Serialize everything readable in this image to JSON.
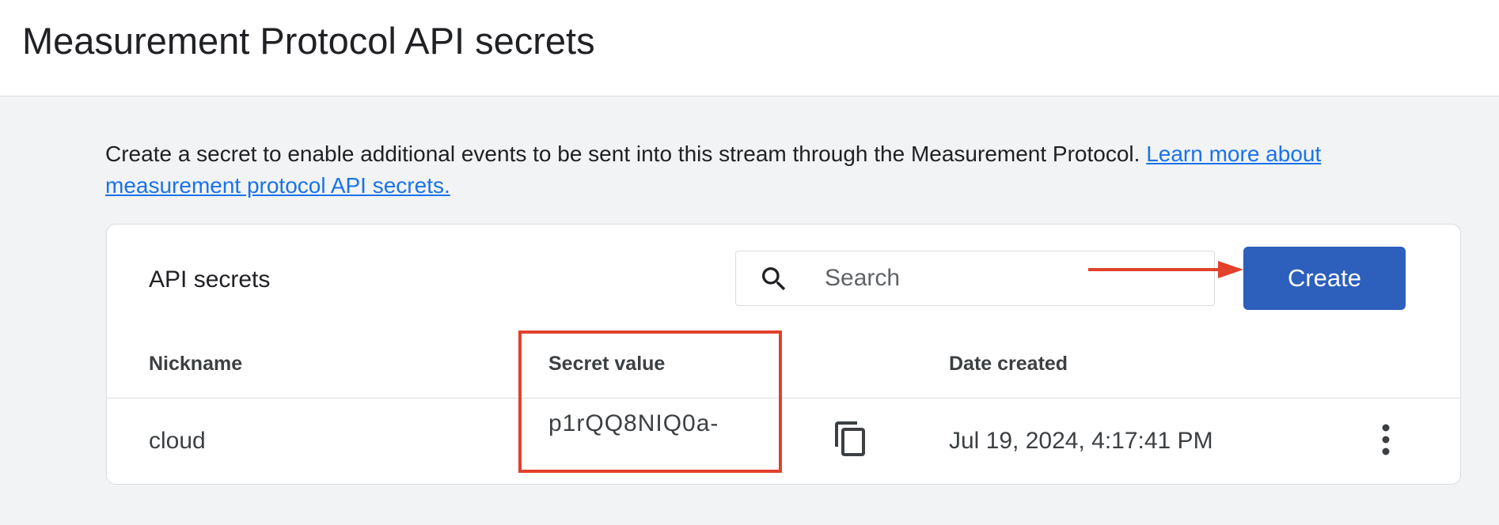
{
  "page": {
    "title": "Measurement Protocol API secrets"
  },
  "intro": {
    "text": "Create a secret to enable additional events to be sent into this stream through the Measurement Protocol. ",
    "link_text": "Learn more about measurement protocol API secrets."
  },
  "card": {
    "title": "API secrets",
    "search": {
      "placeholder": "Search",
      "value": "",
      "icon": "search-icon"
    },
    "create_label": "Create",
    "columns": [
      "Nickname",
      "Secret value",
      "Date created"
    ],
    "rows": [
      {
        "nickname": "cloud",
        "secret_value": "p1rQQ8NIQ0a-",
        "date_created": "Jul 19, 2024, 4:17:41 PM",
        "copy_icon": "copy-icon",
        "menu_icon": "more-vert-icon"
      }
    ]
  },
  "annotations": {
    "color": "#e2412b",
    "arrow_target": "Create",
    "highlight_target": "Secret value"
  },
  "colors": {
    "accent": "#2d5fbd",
    "link": "#1a73e8",
    "background": "#f1f3f4"
  }
}
